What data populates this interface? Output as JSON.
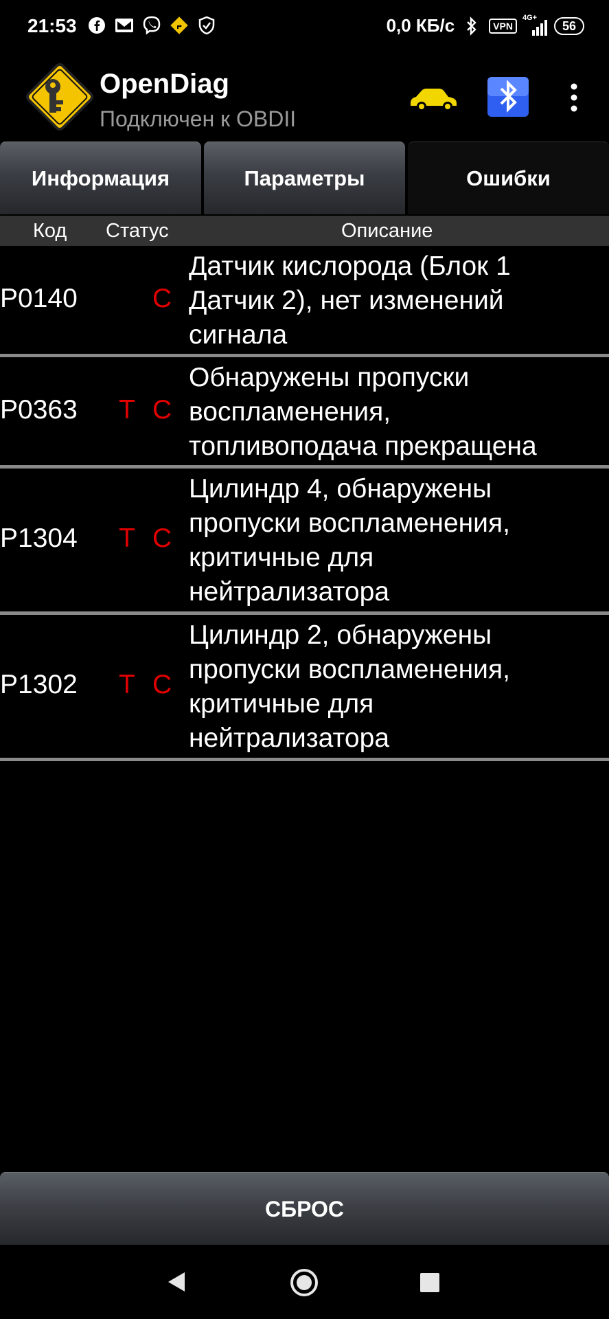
{
  "status_bar": {
    "time": "21:53",
    "net_speed": "0,0 КБ/с",
    "vpn": "VPN",
    "network": "4G+",
    "battery": "56"
  },
  "app": {
    "title": "OpenDiag",
    "subtitle": "Подключен к OBDII"
  },
  "tabs": [
    {
      "label": "Информация"
    },
    {
      "label": "Параметры"
    },
    {
      "label": "Ошибки"
    }
  ],
  "table": {
    "headers": {
      "code": "Код",
      "status": "Статус",
      "description": "Описание"
    },
    "rows": [
      {
        "code": "P0140",
        "t": "",
        "c": "C",
        "description": [
          "Датчик кислорода (Блок 1",
          "Датчик 2), нет изменений",
          "сигнала"
        ]
      },
      {
        "code": "P0363",
        "t": "T",
        "c": "C",
        "description": [
          "Обнаружены пропуски",
          "воспламенения,",
          "топливоподача прекращена"
        ]
      },
      {
        "code": "P1304",
        "t": "T",
        "c": "C",
        "description": [
          "Цилиндр 4, обнаружены",
          "пропуски воспламенения,",
          "критичные для",
          "нейтрализатора"
        ]
      },
      {
        "code": "P1302",
        "t": "T",
        "c": "C",
        "description": [
          "Цилиндр 2, обнаружены",
          "пропуски воспламенения,",
          "критичные для",
          "нейтрализатора"
        ]
      }
    ]
  },
  "reset_label": "СБРОС",
  "colors": {
    "status_red": "#e00000",
    "car_yellow": "#f2d600",
    "bt_blue": "#2f5ff0"
  },
  "icons": [
    "facebook-icon",
    "mail-icon",
    "viber-icon",
    "navigation-icon",
    "shield-icon",
    "bluetooth-icon",
    "signal-icon",
    "battery-icon",
    "car-icon",
    "menu-icon",
    "back-icon",
    "home-icon",
    "recents-icon"
  ]
}
